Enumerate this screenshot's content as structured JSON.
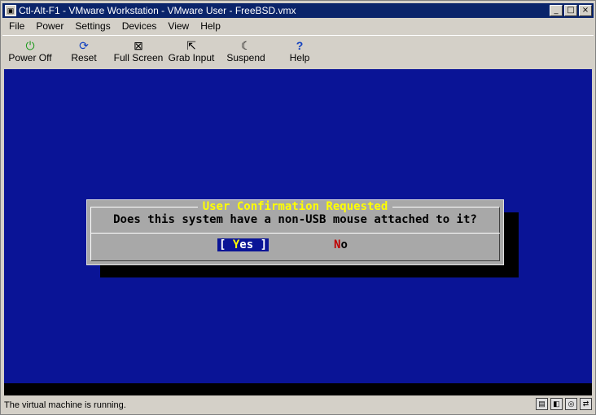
{
  "window": {
    "title": "Ctl-Alt-F1 - VMware Workstation - VMware User - FreeBSD.vmx"
  },
  "title_buttons": {
    "minimize": "_",
    "maximize": "□",
    "close": "×"
  },
  "menu": [
    {
      "label": "File"
    },
    {
      "label": "Power"
    },
    {
      "label": "Settings"
    },
    {
      "label": "Devices"
    },
    {
      "label": "View"
    },
    {
      "label": "Help"
    }
  ],
  "toolbar": [
    {
      "label": "Power Off",
      "icon": "power-icon",
      "glyph": "⏻"
    },
    {
      "label": "Reset",
      "icon": "reset-icon",
      "glyph": "⟳"
    },
    {
      "label": "Full Screen",
      "icon": "fullscreen-icon",
      "glyph": "⊠"
    },
    {
      "label": "Grab Input",
      "icon": "cursor-icon",
      "glyph": "⇱"
    },
    {
      "label": "Suspend",
      "icon": "moon-icon",
      "glyph": "☾"
    },
    {
      "label": "Help",
      "icon": "help-icon",
      "glyph": "?"
    }
  ],
  "dialog": {
    "title": "User Confirmation Requested",
    "message": "Does this system have a non-USB mouse attached to it?",
    "yes_open": "[ ",
    "yes_hot": "Y",
    "yes_rest": "es ]",
    "no_hot": "N",
    "no_rest": "o"
  },
  "status": {
    "text": "The virtual machine is running.",
    "icons": [
      "disk-icon",
      "cdrom-icon",
      "floppy-icon",
      "network-icon"
    ]
  },
  "colors": {
    "guest_background": "#0a1496",
    "dialog_title": "#ffff00",
    "titlebar": "#0a246a"
  }
}
